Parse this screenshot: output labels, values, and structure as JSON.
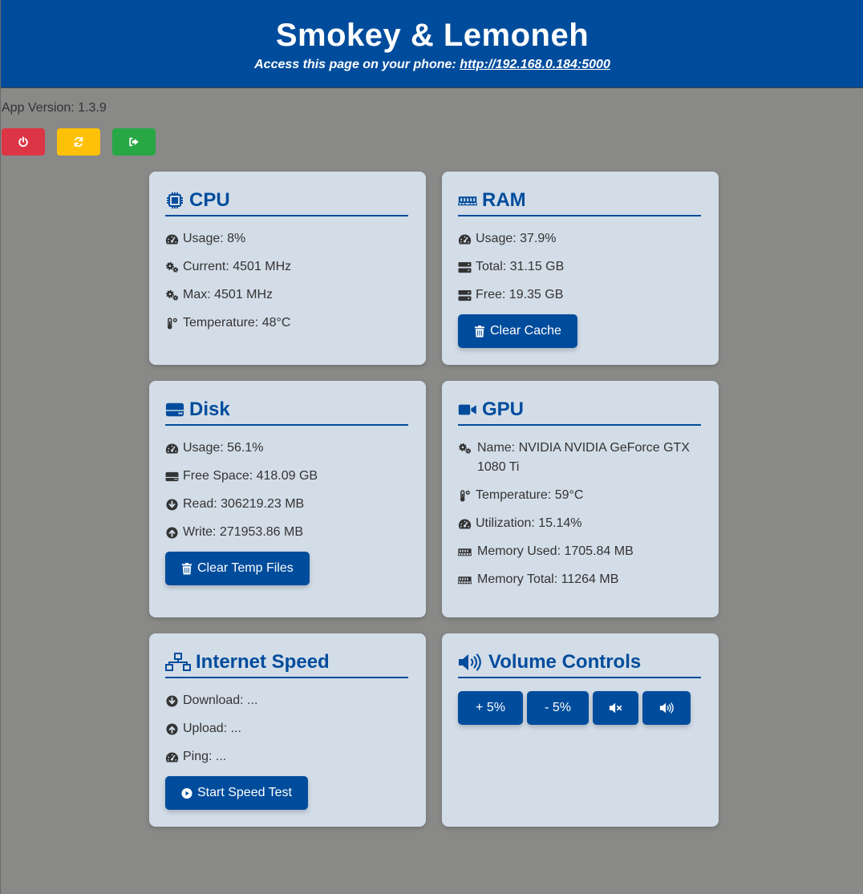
{
  "header": {
    "title": "Smokey & Lemoneh",
    "access_prefix": "Access this page on your phone:",
    "access_url": "http://192.168.0.184:5000"
  },
  "app_version": "App Version: 1.3.9",
  "controls": [
    {
      "icon": "power-icon",
      "color": "#dc3545"
    },
    {
      "icon": "refresh-icon",
      "color": "#ffc107"
    },
    {
      "icon": "sign-out-icon",
      "color": "#28a745"
    }
  ],
  "cpu": {
    "title": "CPU",
    "usage": "Usage: 8%",
    "current": "Current: 4501 MHz",
    "max": "Max: 4501 MHz",
    "temperature": "Temperature: 48°C"
  },
  "ram": {
    "title": "RAM",
    "usage": "Usage: 37.9%",
    "total": "Total: 31.15 GB",
    "free": "Free: 19.35 GB",
    "button": "Clear Cache"
  },
  "disk": {
    "title": "Disk",
    "usage": "Usage: 56.1%",
    "free_space": "Free Space: 418.09 GB",
    "read": "Read: 306219.23 MB",
    "write": "Write: 271953.86 MB",
    "button": "Clear Temp Files"
  },
  "gpu": {
    "title": "GPU",
    "name": "Name: NVIDIA NVIDIA GeForce GTX 1080 Ti",
    "temperature": "Temperature: 59°C",
    "utilization": "Utilization: 15.14%",
    "memory_used": "Memory Used: 1705.84 MB",
    "memory_total": "Memory Total: 11264 MB"
  },
  "internet": {
    "title": "Internet Speed",
    "download": "Download: ...",
    "upload": "Upload: ...",
    "ping": "Ping: ...",
    "button": "Start Speed Test"
  },
  "volume": {
    "title": "Volume Controls",
    "up_label": "+ 5%",
    "down_label": "- 5%"
  },
  "colors": {
    "primary": "#004c9c",
    "background": "#898988",
    "card": "#d3dde8"
  }
}
